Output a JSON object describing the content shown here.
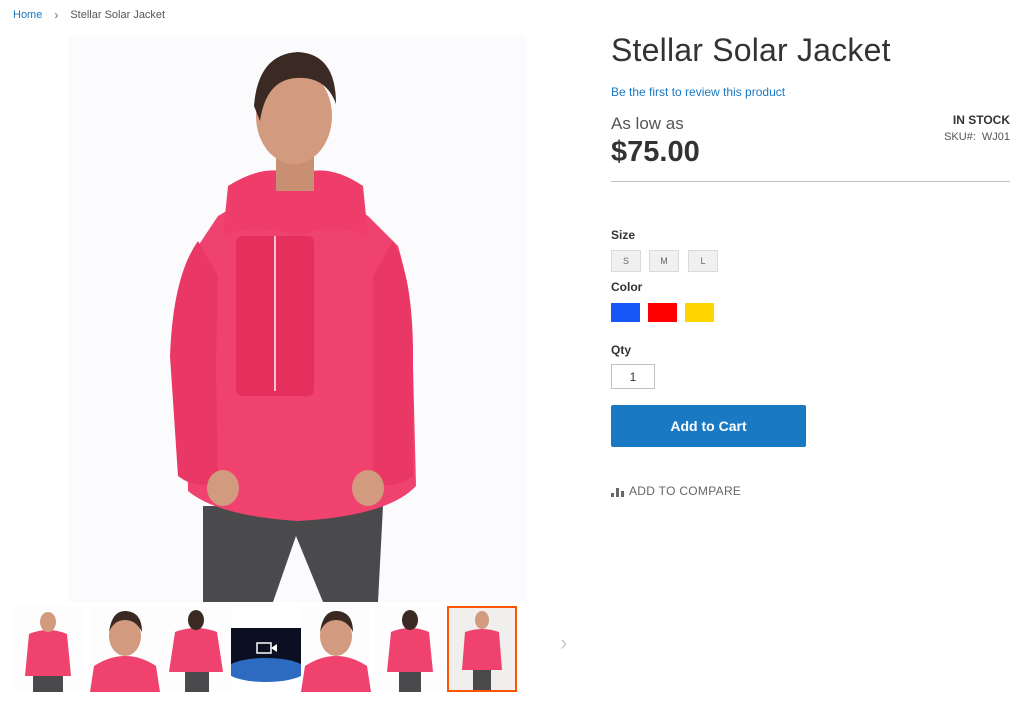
{
  "breadcrumb": {
    "home": "Home",
    "separator": "›",
    "current": "Stellar Solar Jacket"
  },
  "product": {
    "title": "Stellar Solar Jacket",
    "review_link": "Be the first to review this product",
    "price_prefix": "As low as",
    "price": "$75.00",
    "stock": "IN STOCK",
    "sku_label": "SKU#:",
    "sku": "WJ01"
  },
  "options": {
    "size_label": "Size",
    "sizes": [
      "S",
      "M",
      "L"
    ],
    "color_label": "Color",
    "colors": [
      {
        "name": "Blue",
        "hex": "#1857f7"
      },
      {
        "name": "Red",
        "hex": "#ff0000"
      },
      {
        "name": "Yellow",
        "hex": "#ffd500"
      }
    ],
    "qty_label": "Qty",
    "qty_value": "1"
  },
  "actions": {
    "add_to_cart": "Add to Cart",
    "compare": "Add to Compare"
  },
  "gallery": {
    "thumbnail_count": 7,
    "active_index": 6,
    "video_index": 3,
    "accent": "#ff5501",
    "jacket_color": "#f0426f",
    "pants_color": "#4a4a4c"
  },
  "colors": {
    "link": "#1979c3",
    "button": "#1979c3"
  }
}
